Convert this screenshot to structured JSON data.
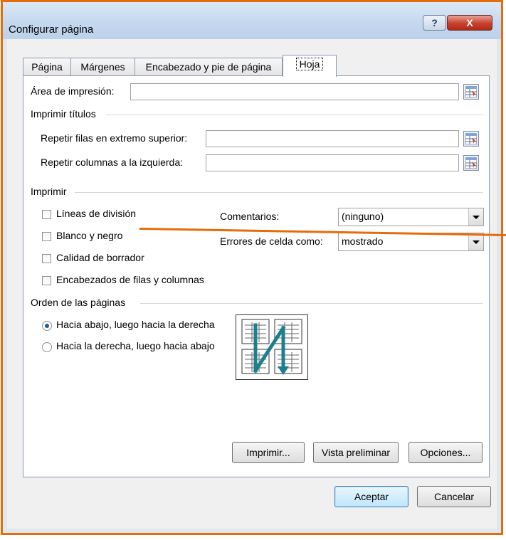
{
  "window": {
    "title": "Configurar página",
    "help_label": "?",
    "close_label": "X"
  },
  "tabs": [
    {
      "label": "Página"
    },
    {
      "label": "Márgenes"
    },
    {
      "label": "Encabezado y pie de página"
    },
    {
      "label": "Hoja",
      "active": true
    }
  ],
  "print_area": {
    "label": "Área de impresión:",
    "value": ""
  },
  "print_titles": {
    "group_label": "Imprimir títulos",
    "repeat_rows_label": "Repetir filas en extremo superior:",
    "repeat_cols_label": "Repetir columnas a la izquierda:"
  },
  "print": {
    "group_label": "Imprimir",
    "checkboxes": [
      {
        "label": "Líneas de división",
        "checked": false
      },
      {
        "label": "Blanco y negro",
        "checked": false
      },
      {
        "label": "Calidad de borrador",
        "checked": false
      },
      {
        "label": "Encabezados de filas y columnas",
        "checked": false
      }
    ],
    "comments_label": "Comentarios:",
    "comments_value": "(ninguno)",
    "errors_label": "Errores de celda como:",
    "errors_value": "mostrado"
  },
  "page_order": {
    "group_label": "Orden de las páginas",
    "options": [
      {
        "label": "Hacia abajo, luego hacia la derecha",
        "selected": true
      },
      {
        "label": "Hacia la derecha, luego hacia abajo",
        "selected": false
      }
    ]
  },
  "panel_buttons": {
    "print": "Imprimir...",
    "preview": "Vista preliminar",
    "options": "Opciones..."
  },
  "dialog_buttons": {
    "ok": "Aceptar",
    "cancel": "Cancelar"
  },
  "colors": {
    "highlight": "#e46c0a",
    "accent": "#1b5aa8",
    "order_arrow": "#1e7f8c"
  }
}
